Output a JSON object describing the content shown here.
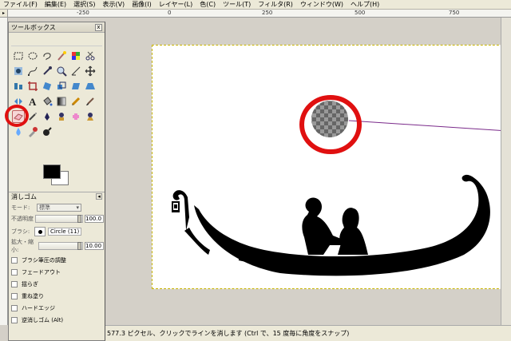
{
  "menubar": {
    "items": [
      "ファイル(F)",
      "編集(E)",
      "選択(S)",
      "表示(V)",
      "画像(I)",
      "レイヤー(L)",
      "色(C)",
      "ツール(T)",
      "フィルタ(R)",
      "ウィンドウ(W)",
      "ヘルプ(H)"
    ]
  },
  "ruler": {
    "labels": [
      "-250",
      "0",
      "250",
      "500",
      "750"
    ]
  },
  "toolbox": {
    "title": "ツールボックス",
    "close": "x",
    "tools": [
      "rect-select-icon",
      "ellipse-select-icon",
      "lasso-icon",
      "fuzzy-select-icon",
      "color-select-icon",
      "scissors-icon",
      "foreground-select-icon",
      "paths-icon",
      "color-picker-icon",
      "zoom-icon",
      "measure-icon",
      "move-icon",
      "align-icon",
      "crop-icon",
      "rotate-icon",
      "scale-icon",
      "shear-icon",
      "perspective-icon",
      "flip-icon",
      "text-icon",
      "bucket-fill-icon",
      "blend-icon",
      "pencil-icon",
      "paintbrush-icon",
      "eraser-icon",
      "airbrush-icon",
      "ink-icon",
      "clone-icon",
      "heal-icon",
      "perspective-clone-icon",
      "blur-icon",
      "smudge-icon",
      "dodge-icon"
    ],
    "selected_tool": "eraser-icon",
    "options": {
      "header": "消しゴム",
      "mode_label": "モード:",
      "mode_value": "標準",
      "opacity_label": "不透明度",
      "opacity_value": "100.0",
      "opacity_level": 1.0,
      "brush_label": "ブラシ:",
      "brush_name": "Circle (11)",
      "scale_label": "拡大・縮小:",
      "scale_value": "10.00",
      "checks": [
        "ブラシ筆圧の調整",
        "フェードアウト",
        "揺らぎ",
        "重ね塗り",
        "ハードエッジ",
        "逆消しゴム (Alt)"
      ]
    }
  },
  "status": {
    "text": "577.3 ピクセル、クリックでラインを消します (Ctrl で、15 度毎に角度をスナップ)"
  },
  "colors": {
    "accent_red": "#e01010",
    "guide_line": "#7a2a8a"
  }
}
